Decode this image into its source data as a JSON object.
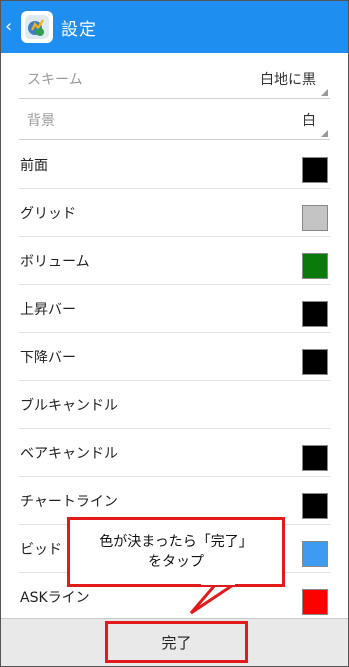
{
  "header": {
    "back_icon": "‹",
    "app_icon": "metatrader-icon",
    "title": "設定"
  },
  "scheme": {
    "label": "スキーム",
    "value": "白地に黒"
  },
  "background": {
    "label": "背景",
    "value": "白"
  },
  "rows": [
    {
      "label": "前面",
      "color": "#000000"
    },
    {
      "label": "グリッド",
      "color": "#c4c4c4"
    },
    {
      "label": "ボリューム",
      "color": "#0a7a0a"
    },
    {
      "label": "上昇バー",
      "color": "#000000"
    },
    {
      "label": "下降バー",
      "color": "#000000"
    },
    {
      "label": "ブルキャンドル",
      "color": null
    },
    {
      "label": "ベアキャンドル",
      "color": "#000000"
    },
    {
      "label": "チャートライン",
      "color": "#000000"
    },
    {
      "label": "ビッド",
      "color": "#3f9bf0"
    },
    {
      "label": "ASKライン",
      "color": "#ff0000"
    }
  ],
  "footer": {
    "done_label": "完了"
  },
  "annotation": {
    "text": "色が決まったら「完了」\nをタップ"
  }
}
